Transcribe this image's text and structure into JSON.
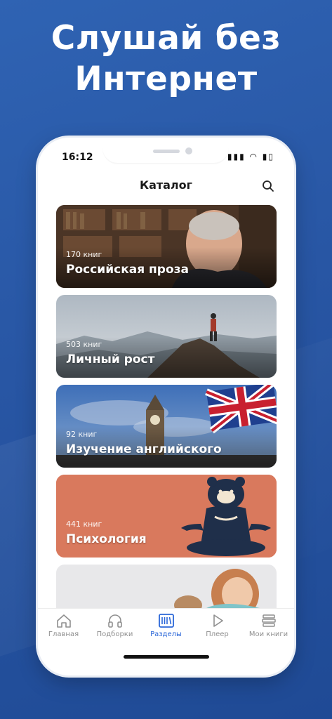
{
  "promo": {
    "line1": "Слушай без",
    "line2": "Интернет"
  },
  "status": {
    "time": "16:12",
    "icons": "▮▮▮ ◠ ▮▯"
  },
  "header": {
    "title": "Каталог"
  },
  "catalog": [
    {
      "count": "170 книг",
      "title": "Российская проза"
    },
    {
      "count": "503 книг",
      "title": "Личный рост"
    },
    {
      "count": "92 книг",
      "title": "Изучение английского"
    },
    {
      "count": "441 книг",
      "title": "Психология"
    }
  ],
  "tabs": [
    {
      "label": "Главная",
      "icon": "home-icon"
    },
    {
      "label": "Подборки",
      "icon": "headphones-icon"
    },
    {
      "label": "Разделы",
      "icon": "shelves-icon",
      "active": true
    },
    {
      "label": "Плеер",
      "icon": "play-icon"
    },
    {
      "label": "Мои книги",
      "icon": "books-stack-icon"
    }
  ],
  "colors": {
    "accent": "#2b67d8",
    "background": "#2f63b3",
    "psychology_card": "#d9795d"
  }
}
